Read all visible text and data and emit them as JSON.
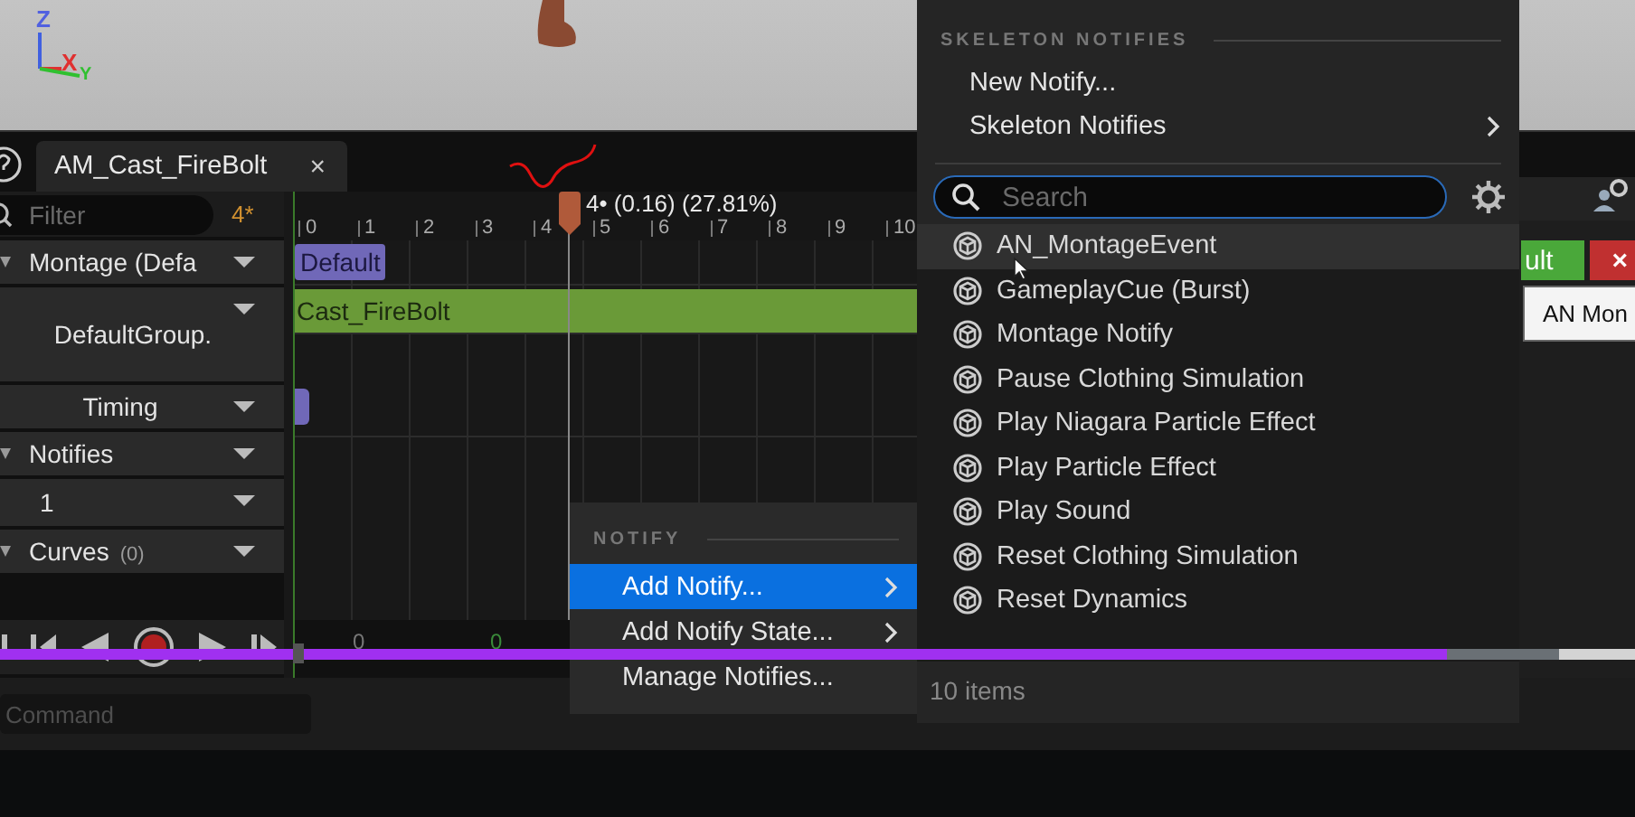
{
  "viewport": {
    "axes": [
      {
        "label": "Z",
        "kind": "z"
      },
      {
        "label": "X",
        "kind": "x"
      },
      {
        "label": "Y",
        "kind": "y"
      }
    ]
  },
  "editor_tab": {
    "title": "AM_Cast_FireBolt",
    "close": "×"
  },
  "track_list": {
    "filter_placeholder": "Filter",
    "count": "4*",
    "rows": [
      {
        "label": "Montage (Defa",
        "kind": "header"
      },
      {
        "label": "DefaultGroup.",
        "kind": "slot"
      },
      {
        "label": "Timing",
        "kind": "section"
      },
      {
        "label": "Notifies",
        "kind": "header"
      },
      {
        "label": "1",
        "kind": "track"
      },
      {
        "label": "Curves",
        "count": "(0)",
        "kind": "header"
      }
    ]
  },
  "timeline": {
    "ticks": [
      "0",
      "1",
      "2",
      "3",
      "4",
      "5",
      "6",
      "7",
      "8",
      "9",
      "10"
    ],
    "playhead_label": "4• (0.16) (27.81%)",
    "section_chip": "Default",
    "segment": "Cast_FireBolt",
    "frame_markers": [
      {
        "label": "0",
        "color": "#777777"
      },
      {
        "label": "0",
        "color": "#3a8a3a"
      }
    ]
  },
  "command": {
    "placeholder": "Command"
  },
  "notify_menu": {
    "header": "NOTIFY",
    "items": [
      {
        "label": "Add Notify...",
        "submenu": true,
        "selected": true
      },
      {
        "label": "Add Notify State...",
        "submenu": true,
        "selected": false
      },
      {
        "label": "Manage Notifies...",
        "submenu": false,
        "selected": false
      }
    ]
  },
  "skeleton_menu": {
    "header": "SKELETON NOTIFIES",
    "items": [
      {
        "label": "New Notify...",
        "submenu": false
      },
      {
        "label": "Skeleton Notifies",
        "submenu": true
      }
    ],
    "search_placeholder": "Search",
    "notifies": [
      {
        "label": "AN_MontageEvent",
        "hovered": true
      },
      {
        "label": "GameplayCue (Burst)",
        "hovered": false
      },
      {
        "label": "Montage Notify",
        "hovered": false
      },
      {
        "label": "Pause Clothing Simulation",
        "hovered": false
      },
      {
        "label": "Play Niagara Particle Effect",
        "hovered": false
      },
      {
        "label": "Play Particle Effect",
        "hovered": false
      },
      {
        "label": "Play Sound",
        "hovered": false
      },
      {
        "label": "Reset Clothing Simulation",
        "hovered": false
      },
      {
        "label": "Reset Dynamics",
        "hovered": false
      }
    ],
    "footer": "10 items"
  },
  "right_panel": {
    "buttons": [
      {
        "label": "ult",
        "kind": "ok"
      },
      {
        "label": "×",
        "kind": "cancel"
      }
    ],
    "tooltip": "AN Mon"
  },
  "video_progress": {
    "level": 0.885,
    "buffer": {
      "level": 0.954
    }
  }
}
